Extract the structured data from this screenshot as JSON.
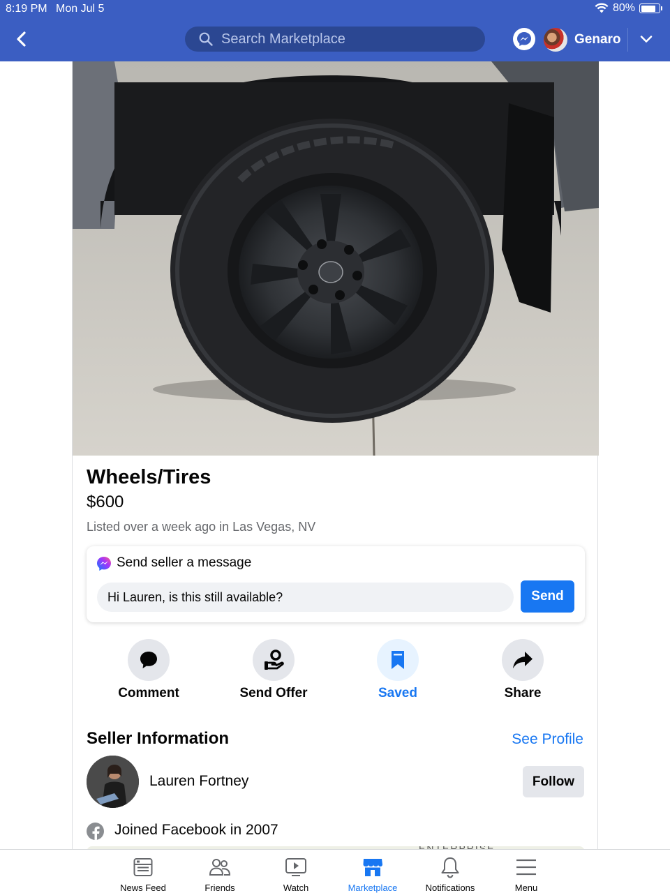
{
  "status_bar": {
    "time": "8:19 PM",
    "date": "Mon Jul 5",
    "battery": "80%",
    "battery_level": 0.8
  },
  "header": {
    "search_placeholder": "Search Marketplace",
    "user_name": "Genaro"
  },
  "listing": {
    "title": "Wheels/Tires",
    "price": "$600",
    "listed": "Listed over a week ago in Las Vegas, NV"
  },
  "message_box": {
    "title": "Send seller a message",
    "input_value": "Hi Lauren, is this still available?",
    "send_label": "Send"
  },
  "actions": [
    {
      "label": "Comment",
      "icon": "comment-icon"
    },
    {
      "label": "Send Offer",
      "icon": "offer-icon"
    },
    {
      "label": "Saved",
      "icon": "bookmark-icon",
      "active": true
    },
    {
      "label": "Share",
      "icon": "share-icon"
    }
  ],
  "seller": {
    "heading": "Seller Information",
    "see_profile": "See Profile",
    "name": "Lauren Fortney",
    "follow_label": "Follow",
    "joined": "Joined Facebook in 2007"
  },
  "map_peek_text": "ENTERPRISE",
  "tabs": [
    {
      "label": "News Feed",
      "icon": "news-feed-icon"
    },
    {
      "label": "Friends",
      "icon": "friends-icon"
    },
    {
      "label": "Watch",
      "icon": "watch-icon"
    },
    {
      "label": "Marketplace",
      "icon": "marketplace-icon",
      "active": true
    },
    {
      "label": "Notifications",
      "icon": "bell-icon"
    },
    {
      "label": "Menu",
      "icon": "menu-icon"
    }
  ],
  "colors": {
    "header_bg": "#3b5ec2",
    "accent": "#1877f2",
    "muted_text": "#65676b",
    "button_gray": "#e4e6eb"
  }
}
